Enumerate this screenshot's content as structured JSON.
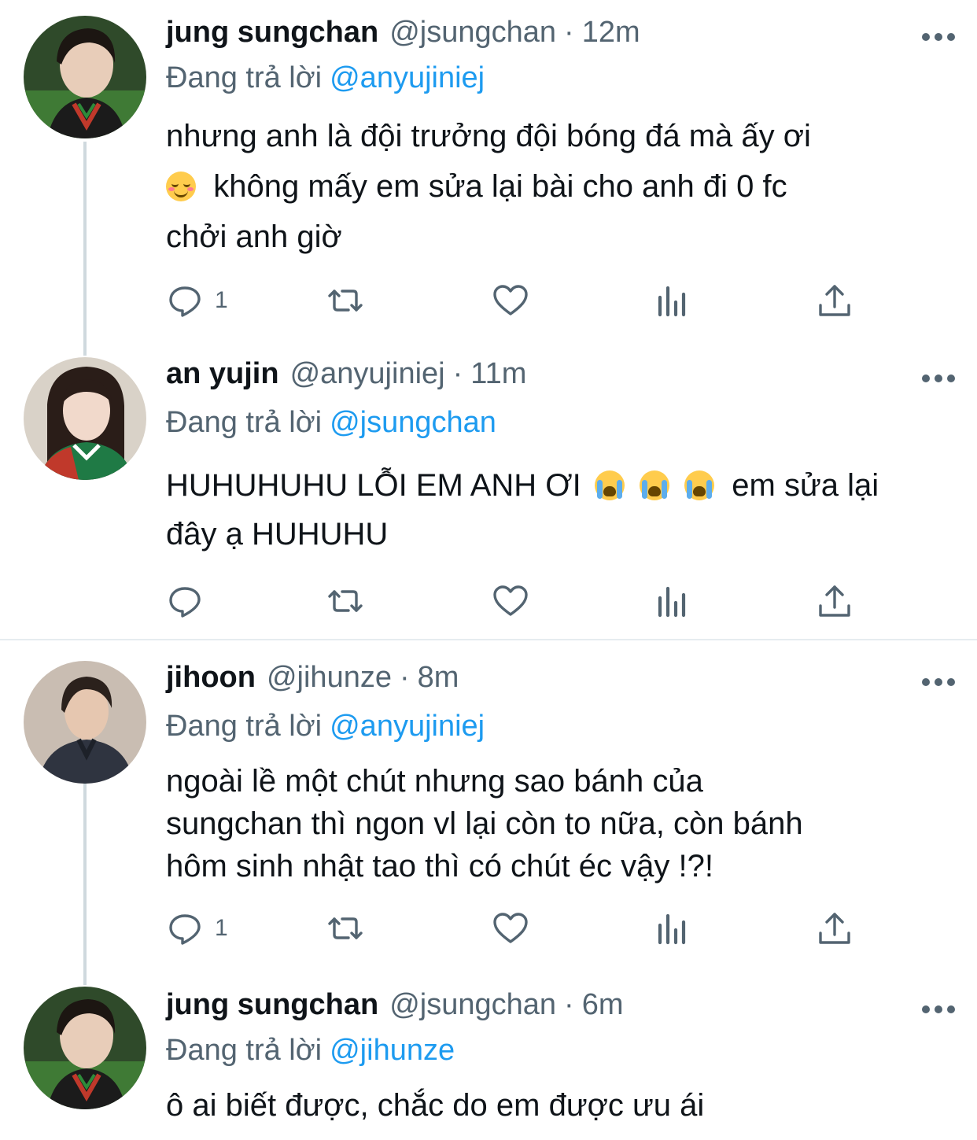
{
  "tweets": [
    {
      "name": "jung sungchan",
      "handle": "@jsungchan",
      "time": "12m",
      "reply_label": "Đang trả lời",
      "reply_to": "@anyujiniej",
      "text_line1": "nhưng anh là đội trưởng đội bóng đá mà ấy ơi",
      "text_line2": "không mấy em sửa lại bài cho anh đi 0 fc",
      "text_line3": "chởi anh giờ",
      "reply_count": "1",
      "avatar_icon": "profile-photo"
    },
    {
      "name": "an yujin",
      "handle": "@anyujiniej",
      "time": "11m",
      "reply_label": "Đang trả lời",
      "reply_to": "@jsungchan",
      "text_line1": "HUHUHUHU LỖI EM ANH ƠI",
      "text_line1b": "em sửa lại",
      "text_line2": "đây ạ HUHUHU",
      "reply_count": "",
      "avatar_icon": "profile-photo"
    },
    {
      "name": "jihoon",
      "handle": "@jihunze",
      "time": "8m",
      "reply_label": "Đang trả lời",
      "reply_to": "@anyujiniej",
      "text_line1": "ngoài lề một chút nhưng sao bánh của",
      "text_line2": "sungchan thì ngon vl lại còn to nữa, còn bánh",
      "text_line3": "hôm sinh nhật tao thì có chút éc vậy !?!",
      "reply_count": "1",
      "avatar_icon": "profile-photo"
    },
    {
      "name": "jung sungchan",
      "handle": "@jsungchan",
      "time": "6m",
      "reply_label": "Đang trả lời",
      "reply_to": "@jihunze",
      "text_line1": "ô ai biết được, chắc do em được ưu ái",
      "avatar_icon": "profile-photo"
    }
  ],
  "separator": "·",
  "icons": {
    "reply": "reply-icon",
    "retweet": "retweet-icon",
    "like": "heart-icon",
    "analytics": "analytics-icon",
    "share": "share-icon",
    "more": "more-icon"
  },
  "colors": {
    "link": "#1d9bf0",
    "secondary": "#536471",
    "text": "#0f1419",
    "line": "#cfd9de"
  }
}
